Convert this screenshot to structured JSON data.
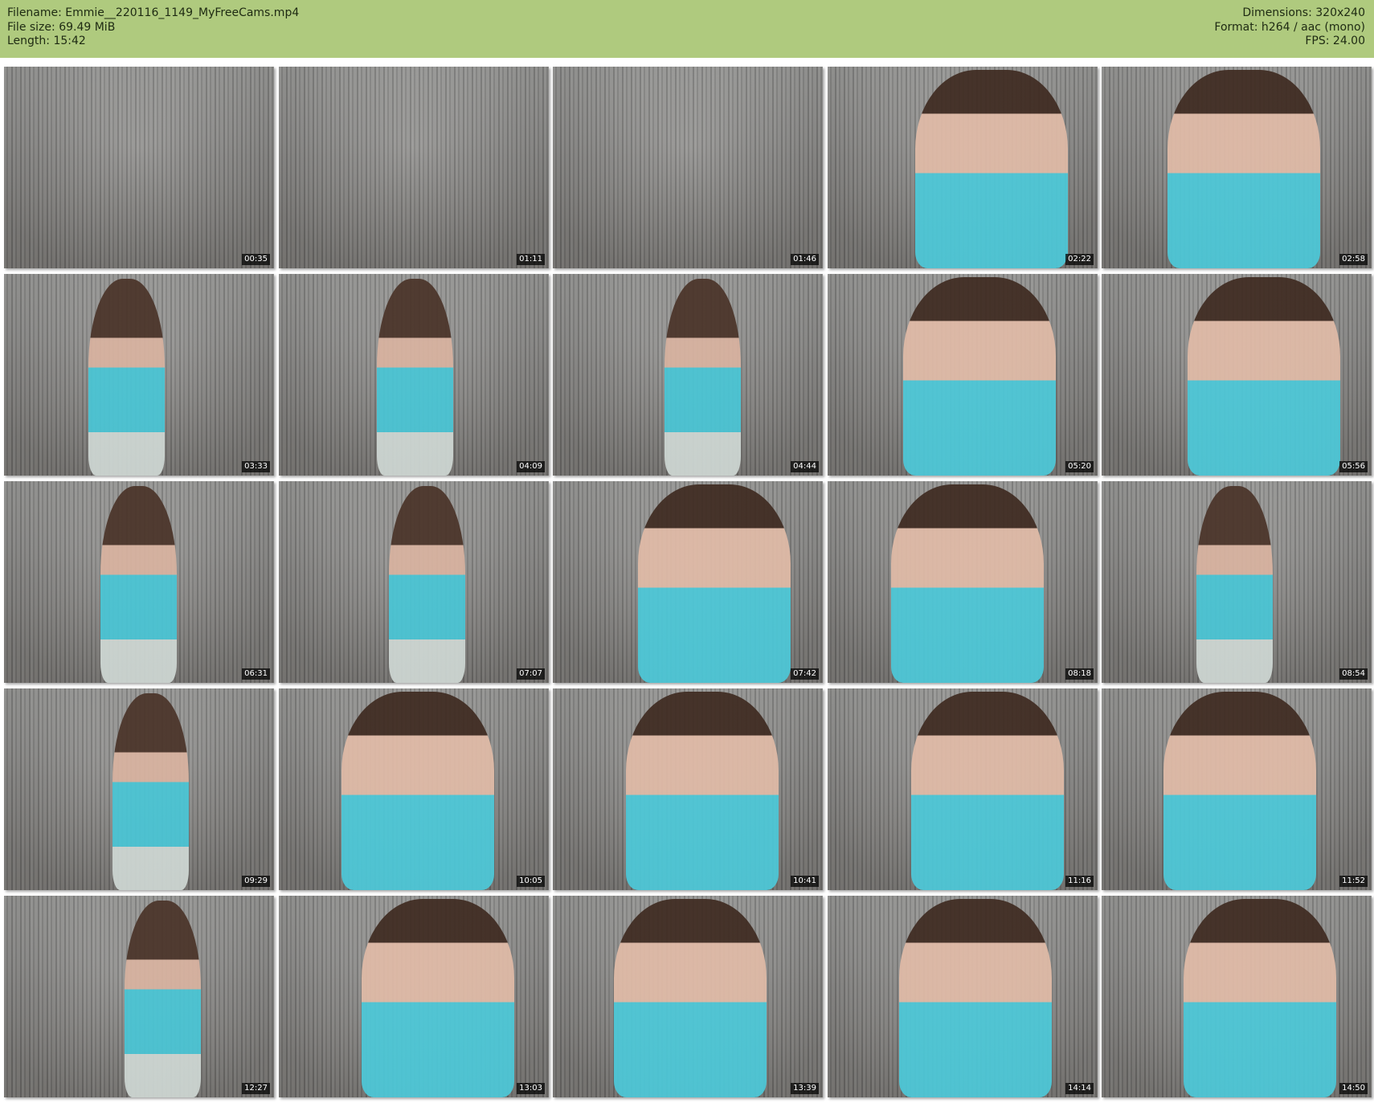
{
  "header": {
    "filename": "Filename: Emmie__220116_1149_MyFreeCams.mp4",
    "filesize": "File size: 69.49 MiB",
    "length": "Length: 15:42",
    "dimensions": "Dimensions: 320x240",
    "format": "Format: h264 / aac (mono)",
    "fps": "FPS: 24.00"
  },
  "thumbnails": [
    {
      "time": "00:35",
      "scene": "empty"
    },
    {
      "time": "01:11",
      "scene": "empty"
    },
    {
      "time": "01:46",
      "scene": "empty"
    },
    {
      "time": "02:22",
      "scene": "close"
    },
    {
      "time": "02:58",
      "scene": "close"
    },
    {
      "time": "03:33",
      "scene": "standing"
    },
    {
      "time": "04:09",
      "scene": "standing"
    },
    {
      "time": "04:44",
      "scene": "standing"
    },
    {
      "time": "05:20",
      "scene": "close"
    },
    {
      "time": "05:56",
      "scene": "close"
    },
    {
      "time": "06:31",
      "scene": "standing"
    },
    {
      "time": "07:07",
      "scene": "standing"
    },
    {
      "time": "07:42",
      "scene": "close"
    },
    {
      "time": "08:18",
      "scene": "close"
    },
    {
      "time": "08:54",
      "scene": "standing"
    },
    {
      "time": "09:29",
      "scene": "standing"
    },
    {
      "time": "10:05",
      "scene": "close"
    },
    {
      "time": "10:41",
      "scene": "close"
    },
    {
      "time": "11:16",
      "scene": "close"
    },
    {
      "time": "11:52",
      "scene": "close"
    },
    {
      "time": "12:27",
      "scene": "standing"
    },
    {
      "time": "13:03",
      "scene": "close"
    },
    {
      "time": "13:39",
      "scene": "close"
    },
    {
      "time": "14:14",
      "scene": "close"
    },
    {
      "time": "14:50",
      "scene": "close"
    }
  ]
}
